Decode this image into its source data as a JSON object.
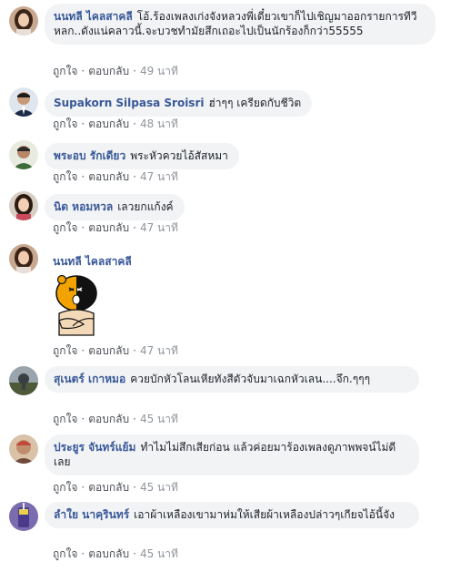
{
  "labels": {
    "like": "ถูกใจ",
    "reply": "ตอบกลับ",
    "separator": "·"
  },
  "comments": [
    {
      "name": "นนทลี ไคลสาคลี",
      "text": "โอ้.ร้องเพลงเก่งจังหลวงพี่เดี๋ยวเขาก็ไปเชิญมาออกรายการทีวีหลก..ดังแน่คลาวนี้.จะบวชทำมัยสึกเถอะไปเป็นนักร้องก็กว่า55555",
      "time": "49 นาที"
    },
    {
      "name": "Supakorn Silpasa Sroisri",
      "text": "ฮ่าๆๆ เครียดกับชีวิต",
      "time": "48 นาที"
    },
    {
      "name": "พระอบ รักเดียว",
      "text": "พระหัวควยไอ้สัสหมา",
      "time": "47 นาที"
    },
    {
      "name": "นิด หอมหวล",
      "text": "เลวยกแก้งค์",
      "time": "47 นาที"
    },
    {
      "name": "นนทลี ไคลสาคลี",
      "text": "",
      "sticker": "crying-bear-sticker",
      "time": "47 นาที"
    },
    {
      "name": "สุเนตร์ เกาหมอ",
      "text": "ควยบักหัวโลนเหียทังสีตัวจับมาเฉกหัวเลน....จึก.ๆๆๆ",
      "time": "45 นาที"
    },
    {
      "name": "ประยูร จันทร์แย้ม",
      "text": "ทำไมไม่สึกเสียก่อน แล้วค่อยมาร้องเพลงดูภาพพจน์ไม่ดีเลย",
      "time": "45 นาที"
    },
    {
      "name": "ลำใย นาคฺรินทร์",
      "text": "เอาผ้าเหลืองเขามาห่มให้เสียผ้าเหลืองปล่าวๆเกียจไอ้นี้จัง",
      "time": "45 นาที"
    }
  ]
}
